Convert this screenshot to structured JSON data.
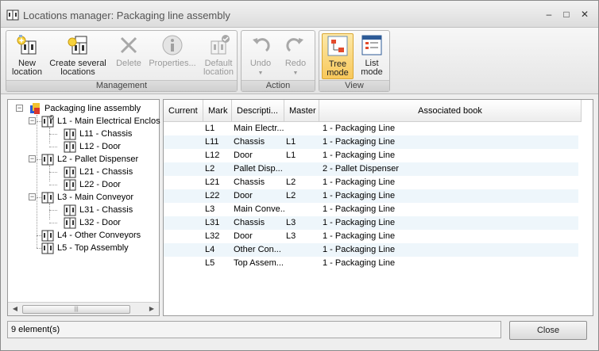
{
  "window": {
    "title": "Locations manager: Packaging line assembly",
    "minimize_glyph": "–",
    "maximize_glyph": "□",
    "close_glyph": "✕"
  },
  "ribbon": {
    "management": {
      "label": "Management",
      "new_location": "New location",
      "create_several": "Create several locations",
      "delete": "Delete",
      "properties": "Properties...",
      "default_location": "Default location"
    },
    "action": {
      "label": "Action",
      "undo": "Undo",
      "redo": "Redo"
    },
    "view": {
      "label": "View",
      "tree_mode": "Tree mode",
      "list_mode": "List mode"
    }
  },
  "tree": {
    "root": "Packaging line assembly",
    "nodes": [
      {
        "label": "L1 - Main Electrical Enclos"
      },
      {
        "label": "L11 - Chassis"
      },
      {
        "label": "L12 - Door"
      },
      {
        "label": "L2 - Pallet Dispenser"
      },
      {
        "label": "L21 - Chassis"
      },
      {
        "label": "L22 - Door"
      },
      {
        "label": "L3 - Main Conveyor"
      },
      {
        "label": "L31 - Chassis"
      },
      {
        "label": "L32 - Door"
      },
      {
        "label": "L4 - Other Conveyors"
      },
      {
        "label": "L5 - Top Assembly"
      }
    ],
    "scroll_thumb_grip": "|||"
  },
  "list": {
    "columns": [
      "Current",
      "Mark",
      "Descripti...",
      "Master",
      "Associated book"
    ],
    "rows": [
      {
        "mark": "L1",
        "description": "Main Electr...",
        "master": "",
        "book": "1 - Packaging Line"
      },
      {
        "mark": "L11",
        "description": "Chassis",
        "master": "L1",
        "book": "1 - Packaging Line"
      },
      {
        "mark": "L12",
        "description": "Door",
        "master": "L1",
        "book": "1 - Packaging Line"
      },
      {
        "mark": "L2",
        "description": "Pallet Disp...",
        "master": "",
        "book": "2 - Pallet Dispenser"
      },
      {
        "mark": "L21",
        "description": "Chassis",
        "master": "L2",
        "book": "1 - Packaging Line"
      },
      {
        "mark": "L22",
        "description": "Door",
        "master": "L2",
        "book": "1 - Packaging Line"
      },
      {
        "mark": "L3",
        "description": "Main Conve...",
        "master": "",
        "book": "1 - Packaging Line"
      },
      {
        "mark": "L31",
        "description": "Chassis",
        "master": "L3",
        "book": "1 - Packaging Line"
      },
      {
        "mark": "L32",
        "description": "Door",
        "master": "L3",
        "book": "1 - Packaging Line"
      },
      {
        "mark": "L4",
        "description": "Other Con...",
        "master": "",
        "book": "1 - Packaging Line"
      },
      {
        "mark": "L5",
        "description": "Top Assem...",
        "master": "",
        "book": "1 - Packaging Line"
      }
    ]
  },
  "status": {
    "text": "9 element(s)",
    "close_label": "Close"
  },
  "colors": {
    "accent_active": "#f8c85b",
    "row_alt": "#eef6fb"
  }
}
